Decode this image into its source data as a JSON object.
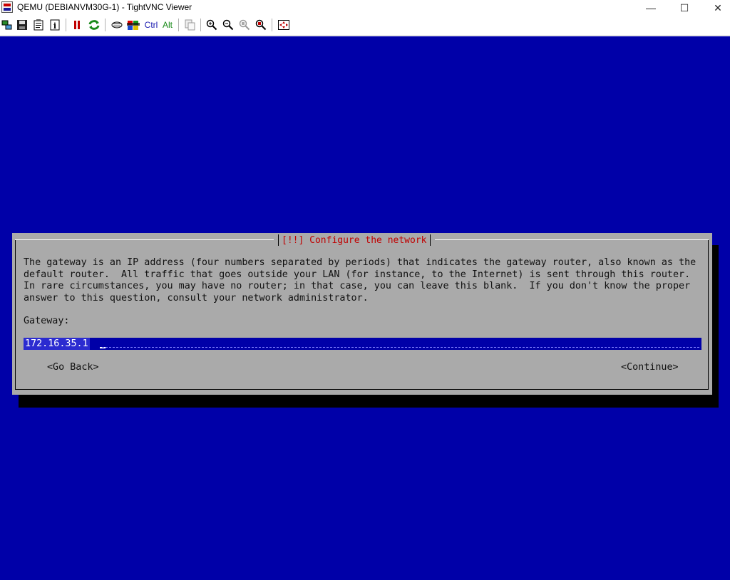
{
  "window": {
    "title": "QEMU (DEBIANVM30G-1) - TightVNC Viewer",
    "controls": {
      "minimize": "—",
      "maximize": "☐",
      "close": "✕"
    }
  },
  "toolbar": {
    "ctrl_label": "Ctrl",
    "alt_label": "Alt",
    "icons": [
      "new-connection-icon",
      "save-icon",
      "options-icon",
      "info-icon",
      "pause-icon",
      "refresh-icon",
      "ctrl-alt-del-icon",
      "ctrl-esc-icon",
      "ctrl-key",
      "alt-key",
      "clipboard-icon",
      "zoom-in-icon",
      "zoom-out-icon",
      "zoom-100-icon",
      "zoom-auto-icon",
      "fullscreen-icon"
    ]
  },
  "installer": {
    "dialog_title": "[!!] Configure the network",
    "description": [
      "The gateway is an IP address (four numbers separated by periods) that indicates the gateway router, also known as the",
      "default router.  All traffic that goes outside your LAN (for instance, to the Internet) is sent through this router.",
      "In rare circumstances, you may have no router; in that case, you can leave this blank.  If you don't know the proper",
      "answer to this question, consult your network administrator."
    ],
    "gateway_label": "Gateway:",
    "gateway_value": "172.16.35.1",
    "go_back_label": "<Go Back>",
    "continue_label": "<Continue>"
  },
  "colors": {
    "screen_background": "#0000a8",
    "dialog_background": "#aaaaaa",
    "title_text": "#c00000",
    "field_background": "#0000a8",
    "field_text": "#ffffff"
  }
}
